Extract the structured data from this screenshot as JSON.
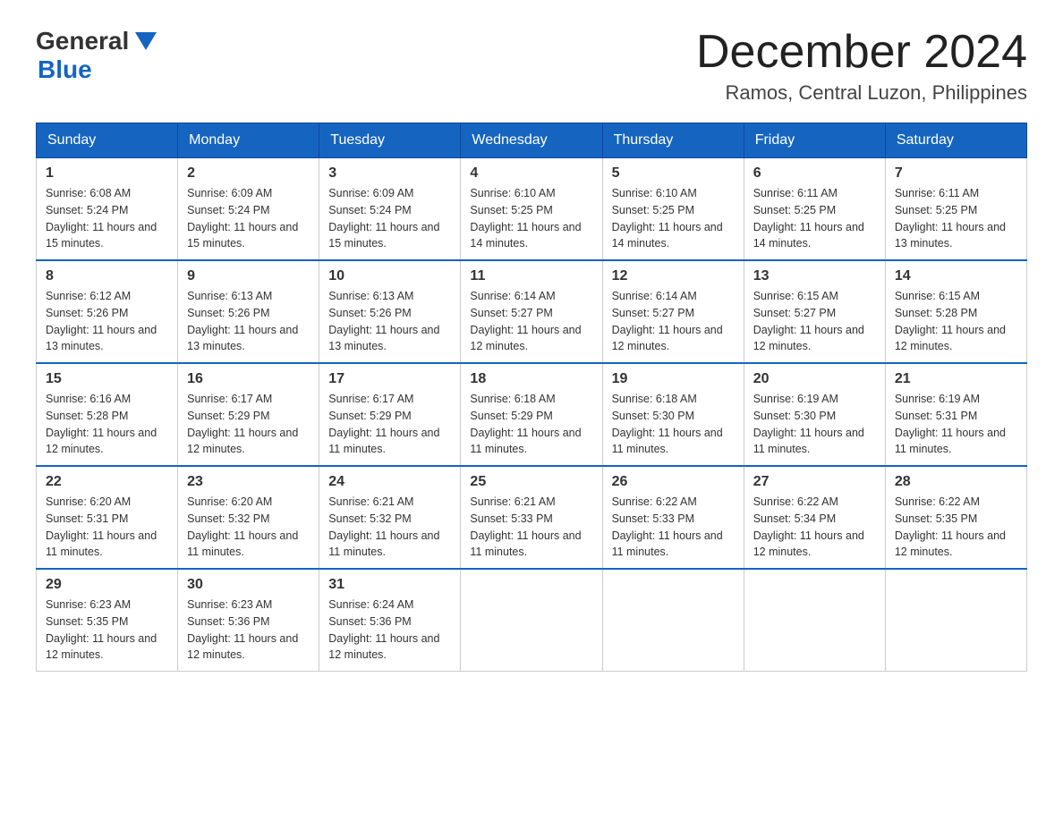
{
  "header": {
    "logo_general": "General",
    "logo_blue": "Blue",
    "month_title": "December 2024",
    "location": "Ramos, Central Luzon, Philippines"
  },
  "days_of_week": [
    "Sunday",
    "Monday",
    "Tuesday",
    "Wednesday",
    "Thursday",
    "Friday",
    "Saturday"
  ],
  "weeks": [
    [
      {
        "day": "1",
        "sunrise": "6:08 AM",
        "sunset": "5:24 PM",
        "daylight": "11 hours and 15 minutes."
      },
      {
        "day": "2",
        "sunrise": "6:09 AM",
        "sunset": "5:24 PM",
        "daylight": "11 hours and 15 minutes."
      },
      {
        "day": "3",
        "sunrise": "6:09 AM",
        "sunset": "5:24 PM",
        "daylight": "11 hours and 15 minutes."
      },
      {
        "day": "4",
        "sunrise": "6:10 AM",
        "sunset": "5:25 PM",
        "daylight": "11 hours and 14 minutes."
      },
      {
        "day": "5",
        "sunrise": "6:10 AM",
        "sunset": "5:25 PM",
        "daylight": "11 hours and 14 minutes."
      },
      {
        "day": "6",
        "sunrise": "6:11 AM",
        "sunset": "5:25 PM",
        "daylight": "11 hours and 14 minutes."
      },
      {
        "day": "7",
        "sunrise": "6:11 AM",
        "sunset": "5:25 PM",
        "daylight": "11 hours and 13 minutes."
      }
    ],
    [
      {
        "day": "8",
        "sunrise": "6:12 AM",
        "sunset": "5:26 PM",
        "daylight": "11 hours and 13 minutes."
      },
      {
        "day": "9",
        "sunrise": "6:13 AM",
        "sunset": "5:26 PM",
        "daylight": "11 hours and 13 minutes."
      },
      {
        "day": "10",
        "sunrise": "6:13 AM",
        "sunset": "5:26 PM",
        "daylight": "11 hours and 13 minutes."
      },
      {
        "day": "11",
        "sunrise": "6:14 AM",
        "sunset": "5:27 PM",
        "daylight": "11 hours and 12 minutes."
      },
      {
        "day": "12",
        "sunrise": "6:14 AM",
        "sunset": "5:27 PM",
        "daylight": "11 hours and 12 minutes."
      },
      {
        "day": "13",
        "sunrise": "6:15 AM",
        "sunset": "5:27 PM",
        "daylight": "11 hours and 12 minutes."
      },
      {
        "day": "14",
        "sunrise": "6:15 AM",
        "sunset": "5:28 PM",
        "daylight": "11 hours and 12 minutes."
      }
    ],
    [
      {
        "day": "15",
        "sunrise": "6:16 AM",
        "sunset": "5:28 PM",
        "daylight": "11 hours and 12 minutes."
      },
      {
        "day": "16",
        "sunrise": "6:17 AM",
        "sunset": "5:29 PM",
        "daylight": "11 hours and 12 minutes."
      },
      {
        "day": "17",
        "sunrise": "6:17 AM",
        "sunset": "5:29 PM",
        "daylight": "11 hours and 11 minutes."
      },
      {
        "day": "18",
        "sunrise": "6:18 AM",
        "sunset": "5:29 PM",
        "daylight": "11 hours and 11 minutes."
      },
      {
        "day": "19",
        "sunrise": "6:18 AM",
        "sunset": "5:30 PM",
        "daylight": "11 hours and 11 minutes."
      },
      {
        "day": "20",
        "sunrise": "6:19 AM",
        "sunset": "5:30 PM",
        "daylight": "11 hours and 11 minutes."
      },
      {
        "day": "21",
        "sunrise": "6:19 AM",
        "sunset": "5:31 PM",
        "daylight": "11 hours and 11 minutes."
      }
    ],
    [
      {
        "day": "22",
        "sunrise": "6:20 AM",
        "sunset": "5:31 PM",
        "daylight": "11 hours and 11 minutes."
      },
      {
        "day": "23",
        "sunrise": "6:20 AM",
        "sunset": "5:32 PM",
        "daylight": "11 hours and 11 minutes."
      },
      {
        "day": "24",
        "sunrise": "6:21 AM",
        "sunset": "5:32 PM",
        "daylight": "11 hours and 11 minutes."
      },
      {
        "day": "25",
        "sunrise": "6:21 AM",
        "sunset": "5:33 PM",
        "daylight": "11 hours and 11 minutes."
      },
      {
        "day": "26",
        "sunrise": "6:22 AM",
        "sunset": "5:33 PM",
        "daylight": "11 hours and 11 minutes."
      },
      {
        "day": "27",
        "sunrise": "6:22 AM",
        "sunset": "5:34 PM",
        "daylight": "11 hours and 12 minutes."
      },
      {
        "day": "28",
        "sunrise": "6:22 AM",
        "sunset": "5:35 PM",
        "daylight": "11 hours and 12 minutes."
      }
    ],
    [
      {
        "day": "29",
        "sunrise": "6:23 AM",
        "sunset": "5:35 PM",
        "daylight": "11 hours and 12 minutes."
      },
      {
        "day": "30",
        "sunrise": "6:23 AM",
        "sunset": "5:36 PM",
        "daylight": "11 hours and 12 minutes."
      },
      {
        "day": "31",
        "sunrise": "6:24 AM",
        "sunset": "5:36 PM",
        "daylight": "11 hours and 12 minutes."
      },
      null,
      null,
      null,
      null
    ]
  ],
  "labels": {
    "sunrise_prefix": "Sunrise: ",
    "sunset_prefix": "Sunset: ",
    "daylight_prefix": "Daylight: "
  }
}
